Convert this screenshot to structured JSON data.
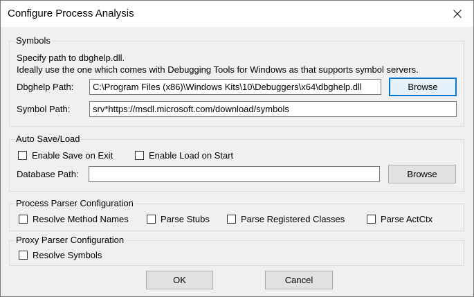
{
  "window": {
    "title": "Configure Process Analysis"
  },
  "symbols": {
    "legend": "Symbols",
    "description_line1": "Specify path to dbghelp.dll.",
    "description_line2": "Ideally use the one which comes with Debugging Tools for Windows as that supports symbol servers.",
    "dbghelp_label": "Dbghelp Path:",
    "dbghelp_value": "C:\\Program Files (x86)\\Windows Kits\\10\\Debuggers\\x64\\dbghelp.dll",
    "browse_label": "Browse",
    "symbol_path_label": "Symbol Path:",
    "symbol_path_value": "srv*https://msdl.microsoft.com/download/symbols"
  },
  "auto_save": {
    "legend": "Auto Save/Load",
    "save_on_exit_label": "Enable Save on Exit",
    "load_on_start_label": "Enable Load on Start",
    "database_label": "Database Path:",
    "database_value": "",
    "browse_label": "Browse"
  },
  "process_parser": {
    "legend": "Process Parser Configuration",
    "resolve_method_names_label": "Resolve Method Names",
    "parse_stubs_label": "Parse Stubs",
    "parse_registered_classes_label": "Parse Registered Classes",
    "parse_actctx_label": "Parse ActCtx"
  },
  "proxy_parser": {
    "legend": "Proxy Parser Configuration",
    "resolve_symbols_label": "Resolve Symbols"
  },
  "buttons": {
    "ok_label": "OK",
    "cancel_label": "Cancel"
  }
}
